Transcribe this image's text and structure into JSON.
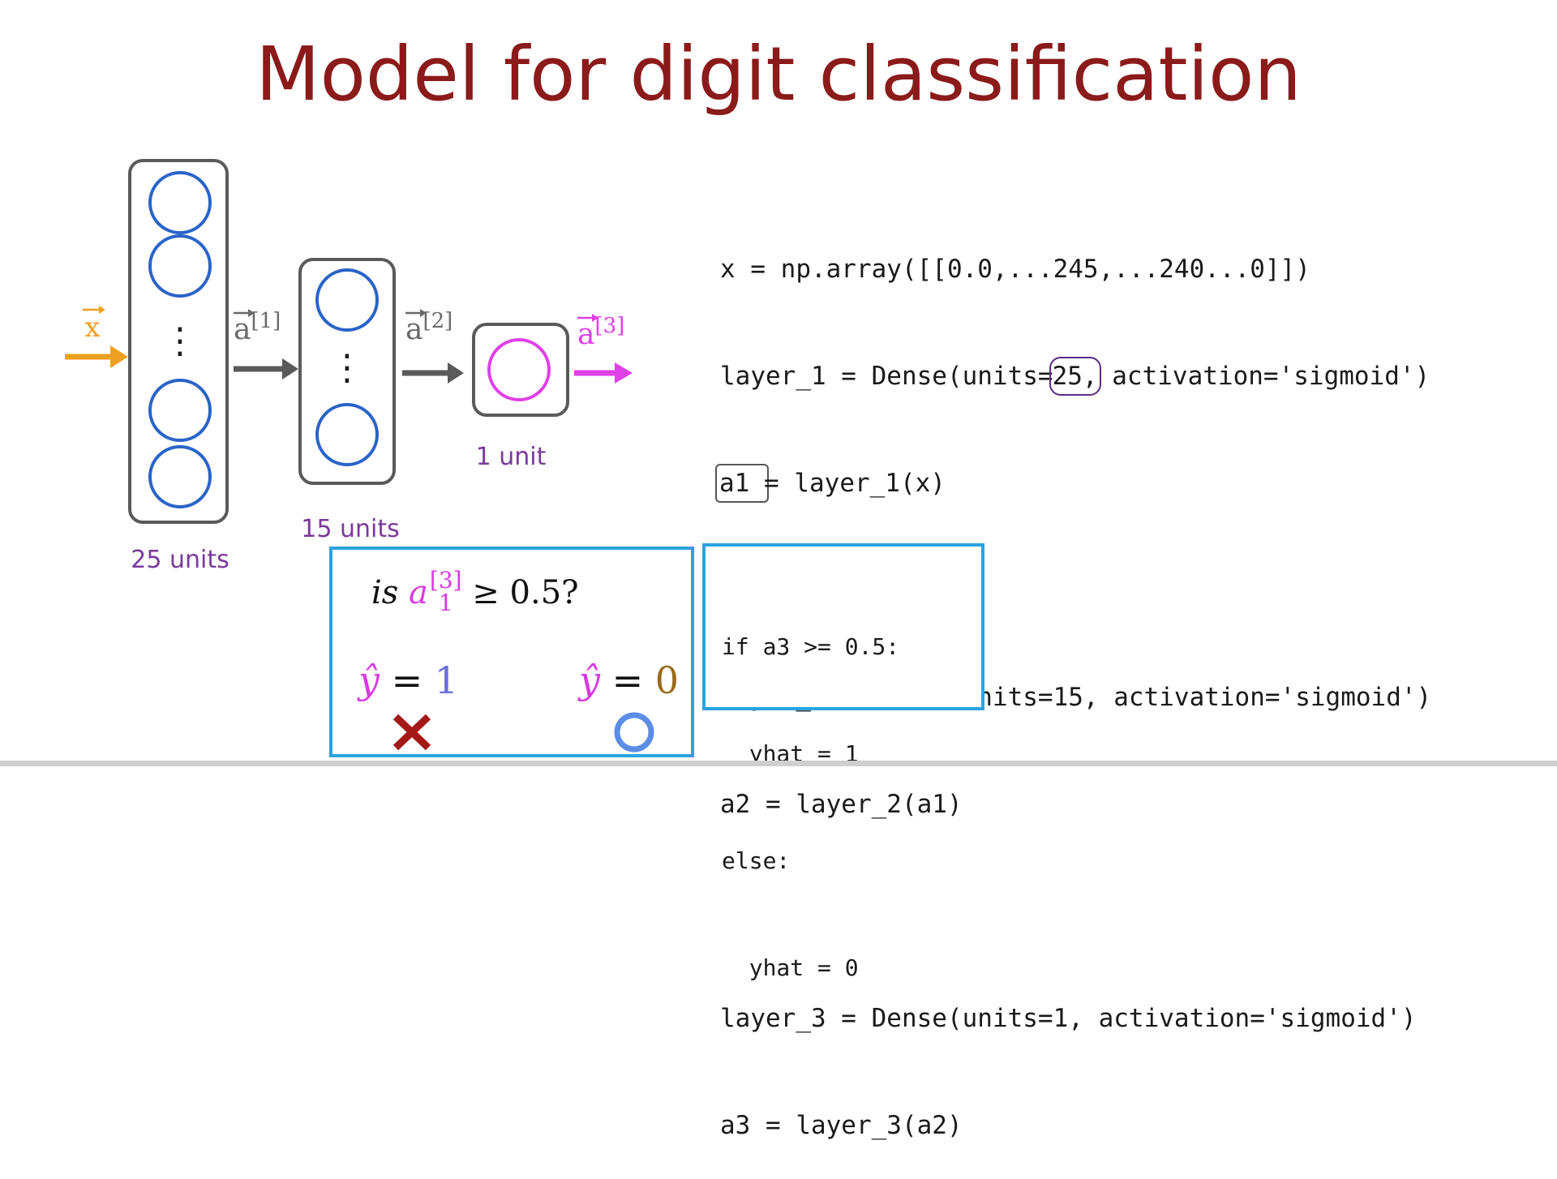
{
  "slide": {
    "title": "Model for digit classification"
  },
  "network": {
    "input_label": "x",
    "arrow_label_1": "a",
    "arrow_label_1_sup": "[1]",
    "arrow_label_2": "a",
    "arrow_label_2_sup": "[2]",
    "arrow_label_3": "a",
    "arrow_label_3_sup": "[3]",
    "ellipsis": "⋮",
    "layer_1_label": "25 units",
    "layer_2_label": "15 units",
    "layer_3_label": "1 unit"
  },
  "code": {
    "line_1": "x = np.array([[0.0,...245,...240...0]])",
    "line_2_pre": "layer_1 = Dense(units=",
    "line_2_hl": "25,",
    "line_2_post": " activation='sigmoid')",
    "line_3_hl": "a1 ",
    "line_3_post": "= layer_1(x)",
    "line_4": "layer_2 = Dense(units=15, activation='sigmoid')",
    "line_5": "a2 = layer_2(a1)",
    "line_6": "layer_3 = Dense(units=1, activation='sigmoid')",
    "line_7": "a3 = layer_3(a2)"
  },
  "decision_box": {
    "is_word": "is",
    "var": "a",
    "var_sup": "[3]",
    "var_sub": "1",
    "condition": "≥ 0.5?",
    "yhat_symbol": "ŷ",
    "equals": "=",
    "value_one": "1",
    "value_zero": "0",
    "one_color": "#6a6fd6",
    "zero_color": "#9a6a1a"
  },
  "threshold_code": {
    "line_1": "if a3 >= 0.5:",
    "line_2": "  yhat = 1",
    "line_3": "else:",
    "line_4": "  yhat = 0"
  },
  "colors": {
    "title": "#8b1a1a",
    "input": "#f0a020",
    "neuron": "#2a64c8",
    "output_neuron": "#e040e8",
    "layer_label": "#7a3a9a",
    "highlight_box": "#2aa3e0",
    "cross": "#a51818",
    "circle_mark": "#5b8de6"
  }
}
